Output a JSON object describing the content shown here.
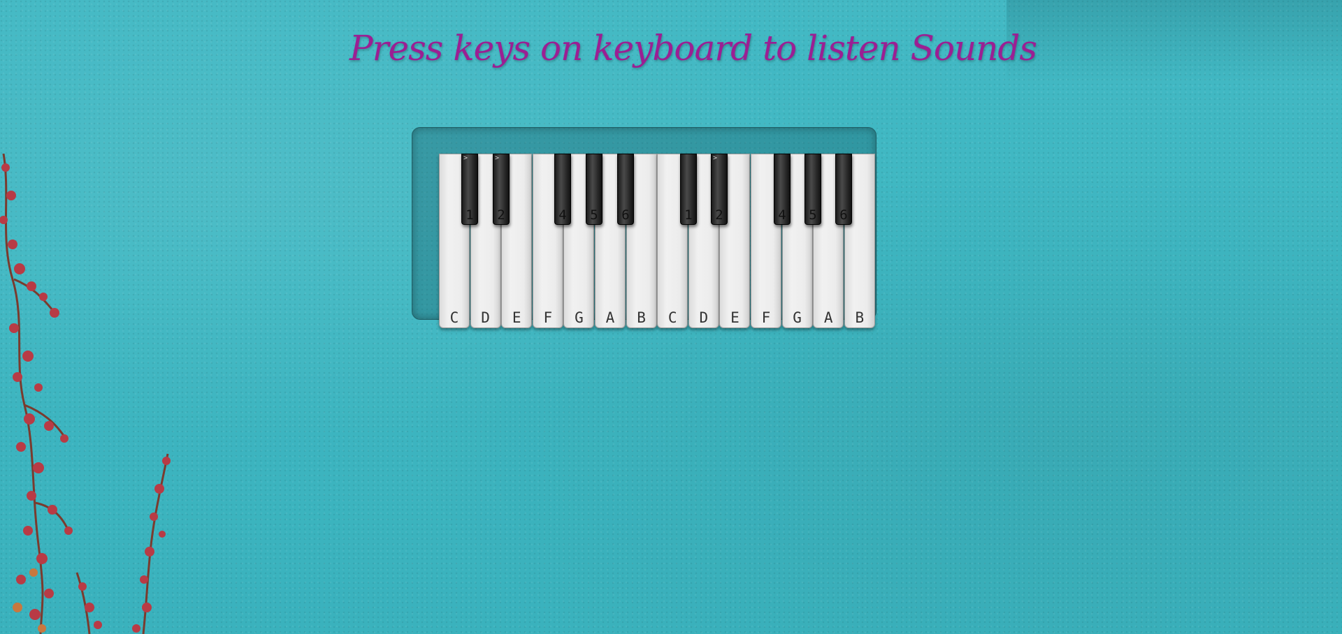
{
  "title": "Press keys on keyboard to listen Sounds",
  "piano": {
    "white_keys": [
      "C",
      "D",
      "E",
      "F",
      "G",
      "A",
      "B",
      "C",
      "D",
      "E",
      "F",
      "G",
      "A",
      "B"
    ],
    "black_keys": [
      {
        "label": "1",
        "mark": ">"
      },
      {
        "label": "2",
        "mark": ">"
      },
      {
        "label": "4",
        "mark": ""
      },
      {
        "label": "5",
        "mark": ""
      },
      {
        "label": "6",
        "mark": ""
      },
      {
        "label": "1",
        "mark": ""
      },
      {
        "label": "2",
        "mark": ">"
      },
      {
        "label": "4",
        "mark": ""
      },
      {
        "label": "5",
        "mark": ""
      },
      {
        "label": "6",
        "mark": ""
      }
    ]
  },
  "colors": {
    "title": "#9b1f93",
    "background": "#3eb7c2"
  }
}
